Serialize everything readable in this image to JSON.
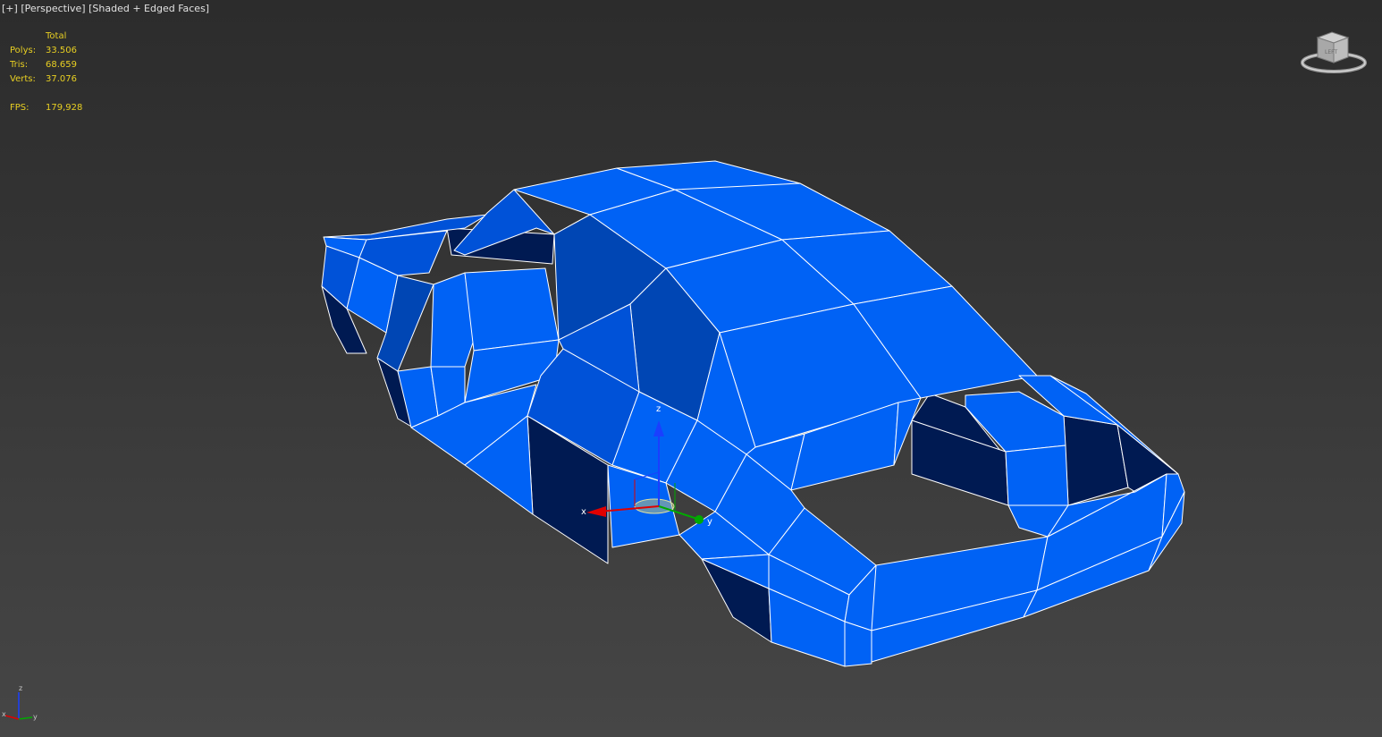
{
  "viewport": {
    "label_plus": "[+]",
    "label_view": "[Perspective]",
    "label_shading": "[Shaded + Edged Faces]"
  },
  "stats": {
    "header": "Total",
    "polys_label": "Polys:",
    "polys_value": "33.506",
    "tris_label": "Tris:",
    "tris_value": "68.659",
    "verts_label": "Verts:",
    "verts_value": "37.076",
    "fps_label": "FPS:",
    "fps_value": "179,928"
  },
  "gizmo": {
    "x_label": "x",
    "y_label": "y",
    "z_label": "z"
  },
  "world_axis": {
    "x_label": "x",
    "y_label": "y",
    "z_label": "z"
  },
  "colors": {
    "mesh_light": "#0062f5",
    "mesh_mid": "#0046b4",
    "mesh_dark": "#001a52",
    "edge": "#ffffff",
    "stats_text": "#e8cf22",
    "gizmo_x": "#e00000",
    "gizmo_y": "#00aa00",
    "gizmo_z": "#1a3fff"
  },
  "icons": {
    "viewcube": "viewcube-icon",
    "world_axis": "world-axis-tripod-icon",
    "gizmo": "transform-gizmo-icon"
  }
}
